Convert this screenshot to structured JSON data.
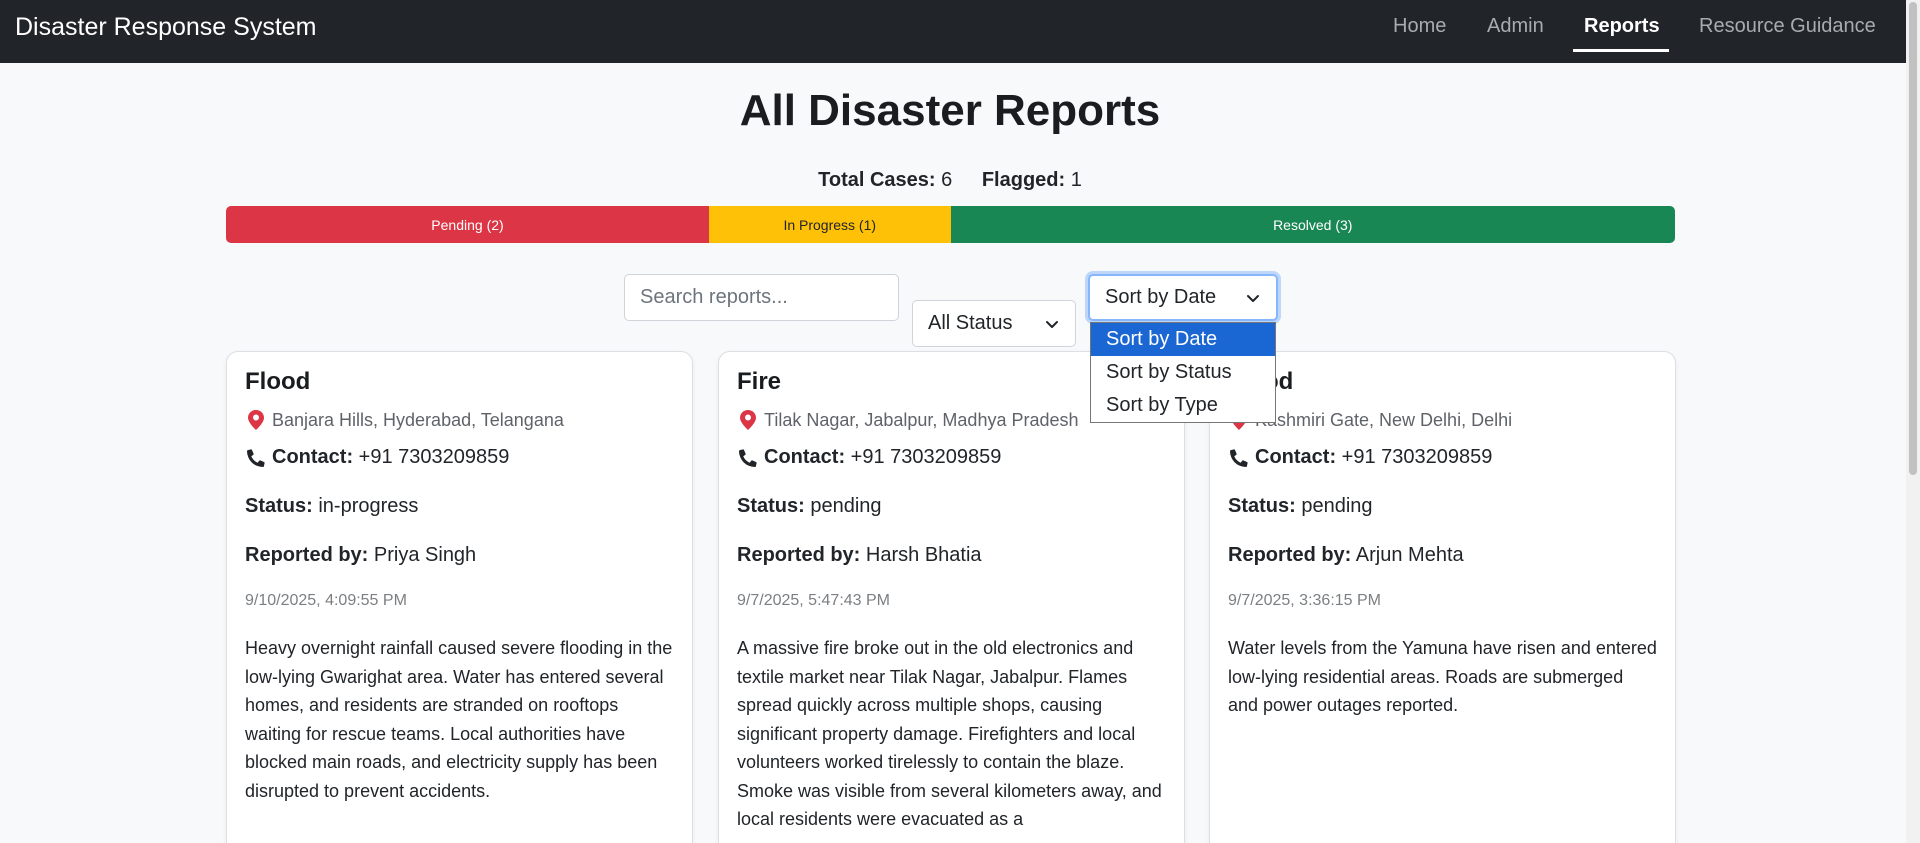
{
  "nav": {
    "brand": "Disaster Response System",
    "links": [
      "Home",
      "Admin",
      "Reports",
      "Resource Guidance"
    ]
  },
  "page": {
    "title": "All Disaster Reports",
    "total_label": "Total Cases:",
    "total_value": "6",
    "flagged_label": "Flagged:",
    "flagged_value": "1"
  },
  "progress": {
    "pending_label": "Pending (2)",
    "in_progress_label": "In Progress (1)",
    "resolved_label": "Resolved (3)",
    "pending_count": 2,
    "in_progress_count": 1,
    "resolved_count": 3,
    "pending_color": "#dc3545",
    "in_progress_color": "#ffc107",
    "resolved_color": "#198754"
  },
  "filters": {
    "search_placeholder": "Search reports...",
    "status_value": "All Status",
    "sort_value": "Sort by Date",
    "sort_options": [
      "Sort by Date",
      "Sort by Status",
      "Sort by Type"
    ]
  },
  "labels": {
    "contact": "Contact:",
    "status": "Status:",
    "reported_by": "Reported by:"
  },
  "reports": [
    {
      "type": "Flood",
      "location": "Banjara Hills, Hyderabad, Telangana",
      "contact": "+91 7303209859",
      "status": "in-progress",
      "reporter": "Priya Singh",
      "date": "9/10/2025, 4:09:55 PM",
      "description": "Heavy overnight rainfall caused severe flooding in the low-lying Gwarighat area. Water has entered several homes, and residents are stranded on rooftops waiting for rescue teams. Local authorities have blocked main roads, and electricity supply has been disrupted to prevent accidents."
    },
    {
      "type": "Fire",
      "location": "Tilak Nagar, Jabalpur, Madhya Pradesh",
      "contact": "+91 7303209859",
      "status": "pending",
      "reporter": "Harsh Bhatia",
      "date": "9/7/2025, 5:47:43 PM",
      "description": "A massive fire broke out in the old electronics and textile market near Tilak Nagar, Jabalpur. Flames spread quickly across multiple shops, causing significant property damage. Firefighters and local volunteers worked tirelessly to contain the blaze. Smoke was visible from several kilometers away, and local residents were evacuated as a"
    },
    {
      "type": "Flood",
      "location": "Kashmiri Gate, New Delhi, Delhi",
      "contact": "+91 7303209859",
      "status": "pending",
      "reporter": "Arjun Mehta",
      "date": "9/7/2025, 3:36:15 PM",
      "description": "Water levels from the Yamuna have risen and entered low-lying residential areas. Roads are submerged and power outages reported."
    }
  ]
}
